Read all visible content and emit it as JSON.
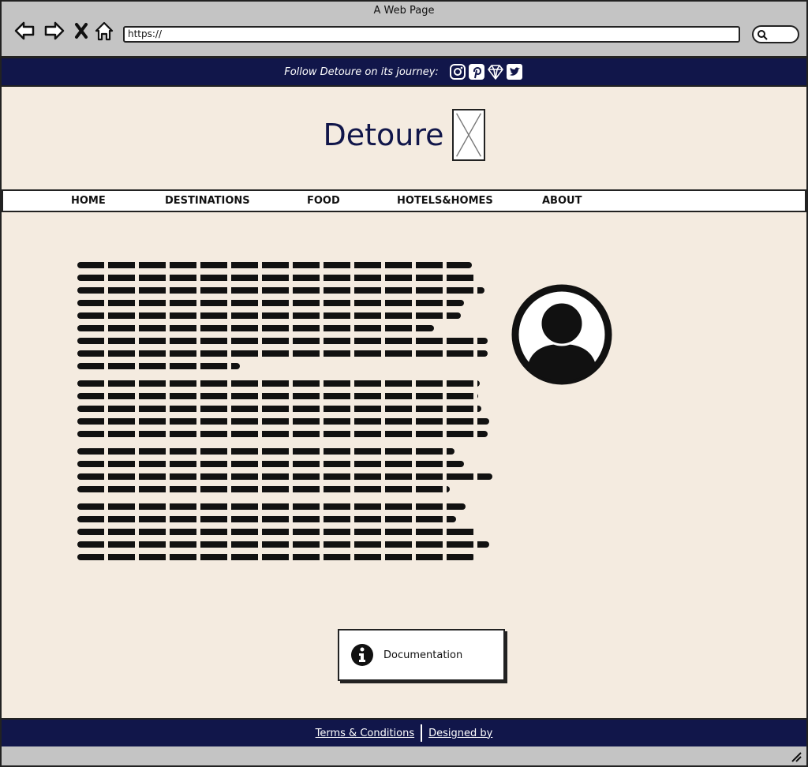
{
  "window": {
    "title": "A Web Page"
  },
  "browser": {
    "url": "https://",
    "icons": [
      "back-arrow-icon",
      "forward-arrow-icon",
      "close-x-icon",
      "home-icon",
      "search-icon"
    ]
  },
  "follow_bar": {
    "text": "Follow Detoure on its journey:",
    "social_icons": [
      "instagram-icon",
      "pinterest-icon",
      "diamond-icon",
      "twitter-icon"
    ]
  },
  "brand": {
    "title": "Detoure"
  },
  "nav": {
    "items": [
      {
        "label": "HOME"
      },
      {
        "label": "DESTINATIONS"
      },
      {
        "label": "FOOD"
      },
      {
        "label": "HOTELS&HOMES"
      },
      {
        "label": "ABOUT"
      }
    ]
  },
  "documentation": {
    "label": "Documentation",
    "icon": "info-icon"
  },
  "footer": {
    "terms": "Terms & Conditions",
    "designed": "Designed by"
  },
  "colors": {
    "navy": "#11164a",
    "page_bg": "#f4ebe0",
    "chrome": "#c4c4c4"
  }
}
